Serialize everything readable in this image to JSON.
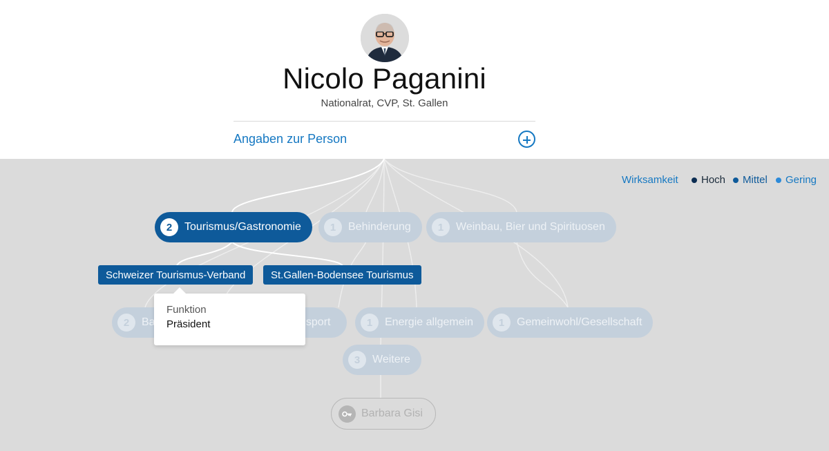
{
  "header": {
    "name": "Nicolo Paganini",
    "subtitle": "Nationalrat, CVP, St. Gallen",
    "details_link": "Angaben zur Person"
  },
  "legend": {
    "title": "Wirksamkeit",
    "items": [
      {
        "label": "Hoch",
        "color": "#0c2d52"
      },
      {
        "label": "Mittel",
        "color": "#0e5a9a"
      },
      {
        "label": "Gering",
        "color": "#2c8ad9"
      }
    ]
  },
  "interests": [
    {
      "count": "2",
      "label": "Tourismus/Gastronomie",
      "state": "active"
    },
    {
      "count": "1",
      "label": "Behinderung",
      "state": "faded"
    },
    {
      "count": "1",
      "label": "Weinbau, Bier und Spirituosen",
      "state": "faded"
    },
    {
      "count": "2",
      "label": "Ba",
      "state": "faded"
    },
    {
      "count": "",
      "label": "nsport",
      "state": "faded"
    },
    {
      "count": "1",
      "label": "Energie allgemein",
      "state": "faded"
    },
    {
      "count": "1",
      "label": "Gemeinwohl/Gesellschaft",
      "state": "faded"
    },
    {
      "count": "3",
      "label": "Weitere",
      "state": "faded"
    }
  ],
  "organizations": [
    {
      "label": "Schweizer Tourismus-Verband"
    },
    {
      "label": "St.Gallen-Bodensee Tourismus"
    }
  ],
  "tooltip": {
    "label": "Funktion",
    "value": "Präsident"
  },
  "guest": {
    "name": "Barbara Gisi",
    "icon": "key-icon"
  },
  "colors": {
    "accent": "#1578c2",
    "active_pill": "#0e5a9a",
    "faded_pill": "#c4d0dc",
    "graph_background": "#dbdbdb"
  }
}
